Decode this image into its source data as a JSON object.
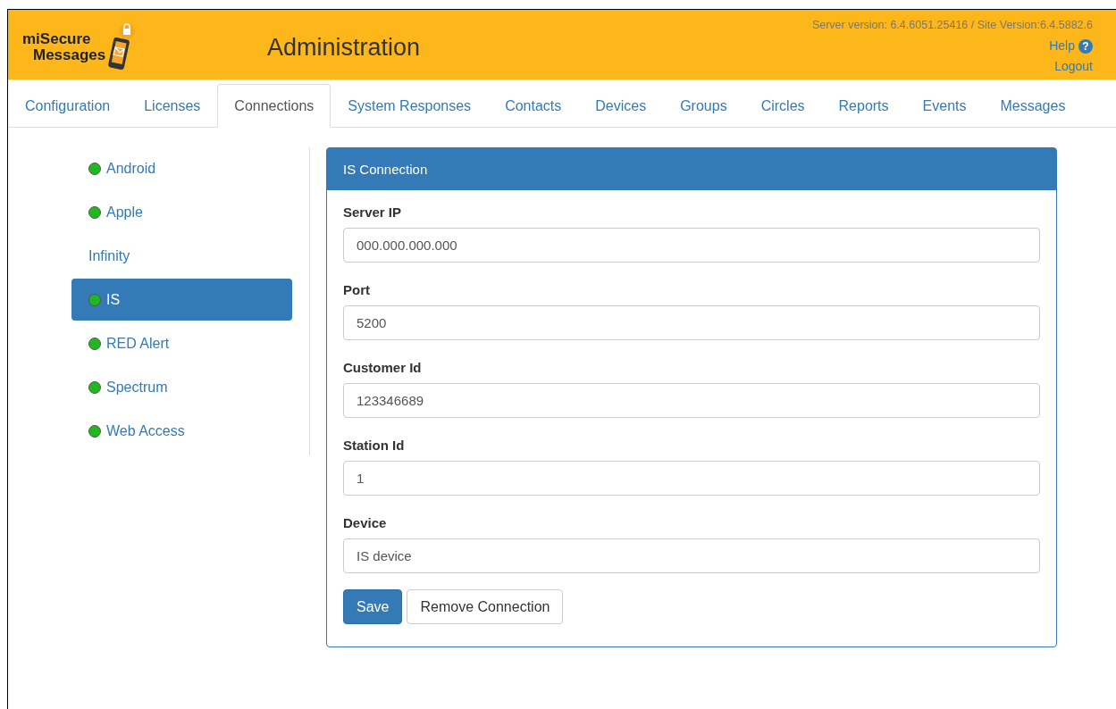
{
  "header": {
    "logo_line1": "miSecure",
    "logo_line2": "Messages",
    "title": "Administration",
    "version": "Server version: 6.4.6051.25416 / Site Version:6.4.5882.6",
    "help": "Help",
    "help_icon": "?",
    "logout": "Logout"
  },
  "tabs": [
    {
      "label": "Configuration",
      "selected": false
    },
    {
      "label": "Licenses",
      "selected": false
    },
    {
      "label": "Connections",
      "selected": true
    },
    {
      "label": "System Responses",
      "selected": false
    },
    {
      "label": "Contacts",
      "selected": false
    },
    {
      "label": "Devices",
      "selected": false
    },
    {
      "label": "Groups",
      "selected": false
    },
    {
      "label": "Circles",
      "selected": false
    },
    {
      "label": "Reports",
      "selected": false
    },
    {
      "label": "Events",
      "selected": false
    },
    {
      "label": "Messages",
      "selected": false
    }
  ],
  "sidebar": {
    "items": [
      {
        "label": "Android",
        "connected": true,
        "selected": false
      },
      {
        "label": "Apple",
        "connected": true,
        "selected": false
      },
      {
        "label": "Infinity",
        "connected": false,
        "selected": false
      },
      {
        "label": "IS",
        "connected": true,
        "selected": true
      },
      {
        "label": "RED Alert",
        "connected": true,
        "selected": false
      },
      {
        "label": "Spectrum",
        "connected": true,
        "selected": false
      },
      {
        "label": "Web Access",
        "connected": true,
        "selected": false
      }
    ]
  },
  "panel": {
    "title": "IS Connection",
    "fields": [
      {
        "label": "Server IP",
        "value": "000.000.000.000"
      },
      {
        "label": "Port",
        "value": "5200"
      },
      {
        "label": "Customer Id",
        "value": "123346689"
      },
      {
        "label": "Station Id",
        "value": "1"
      },
      {
        "label": "Device",
        "value": "IS device"
      }
    ],
    "buttons": [
      {
        "label": "Save",
        "kind": "primary"
      },
      {
        "label": "Remove Connection",
        "kind": "default"
      }
    ]
  }
}
